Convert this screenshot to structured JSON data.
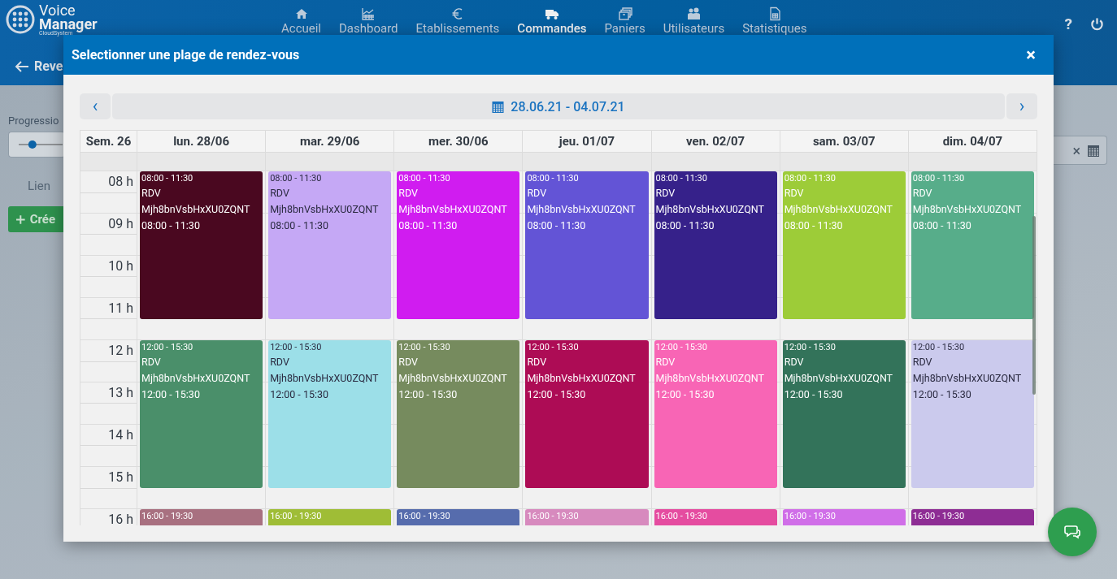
{
  "app": {
    "logo_line1": "Voice",
    "logo_line2": "Manager",
    "logo_line3": "CloudSystem"
  },
  "nav": [
    {
      "label": "Accueil",
      "selected": false
    },
    {
      "label": "Dashboard",
      "selected": false
    },
    {
      "label": "Etablissements",
      "selected": false
    },
    {
      "label": "Commandes",
      "selected": true
    },
    {
      "label": "Paniers",
      "selected": false
    },
    {
      "label": "Utilisateurs",
      "selected": false
    },
    {
      "label": "Statistiques",
      "selected": false
    }
  ],
  "help_label": "?",
  "page": {
    "back_label": "Reve",
    "progress": {
      "label": "Progressio",
      "level": 0.3
    },
    "link_label": "Lien",
    "create_button": "Crée"
  },
  "dialog": {
    "title": "Selectionner une plage de rendez-vous",
    "close": "×",
    "range": "28.06.21 - 04.07.21",
    "prev": "‹",
    "next": "›",
    "week_label": "Sem. 26",
    "hours": [
      "08 h",
      "09 h",
      "10 h",
      "11 h",
      "12 h",
      "13 h",
      "14 h",
      "15 h",
      "16 h"
    ],
    "days": [
      {
        "label": "lun. 28/06",
        "events": [
          {
            "time": "08:00 - 11:30",
            "title": "RDV",
            "ref": "Mjh8bnVsbHxXU0ZQNT",
            "time2": "08:00 - 11:30",
            "color": "#4a0820"
          },
          {
            "time": "12:00 - 15:30",
            "title": "RDV",
            "ref": "Mjh8bnVsbHxXU0ZQNT",
            "time2": "12:00 - 15:30",
            "color": "#4a8f6a"
          },
          {
            "time": "16:00 - 19:30",
            "color": "#a87080"
          }
        ]
      },
      {
        "label": "mar. 29/06",
        "events": [
          {
            "time": "08:00 - 11:30",
            "title": "RDV",
            "ref": "Mjh8bnVsbHxXU0ZQNT",
            "time2": "08:00 - 11:30",
            "color": "#c5a8f5"
          },
          {
            "time": "12:00 - 15:30",
            "title": "RDV",
            "ref": "Mjh8bnVsbHxXU0ZQNT",
            "time2": "12:00 - 15:30",
            "color": "#9cdfe8"
          },
          {
            "time": "16:00 - 19:30",
            "color": "#9fbd36"
          }
        ]
      },
      {
        "label": "mer. 30/06",
        "events": [
          {
            "time": "08:00 - 11:30",
            "title": "RDV",
            "ref": "Mjh8bnVsbHxXU0ZQNT",
            "time2": "08:00 - 11:30",
            "color": "#d01cf0"
          },
          {
            "time": "12:00 - 15:30",
            "title": "RDV",
            "ref": "Mjh8bnVsbHxXU0ZQNT",
            "time2": "12:00 - 15:30",
            "color": "#768b5e"
          },
          {
            "time": "16:00 - 19:30",
            "color": "#566cad"
          }
        ]
      },
      {
        "label": "jeu. 01/07",
        "events": [
          {
            "time": "08:00 - 11:30",
            "title": "RDV",
            "ref": "Mjh8bnVsbHxXU0ZQNT",
            "time2": "08:00 - 11:30",
            "color": "#6354d6"
          },
          {
            "time": "12:00 - 15:30",
            "title": "RDV",
            "ref": "Mjh8bnVsbHxXU0ZQNT",
            "time2": "12:00 - 15:30",
            "color": "#ad0c55"
          },
          {
            "time": "16:00 - 19:30",
            "color": "#d78abe"
          }
        ]
      },
      {
        "label": "ven. 02/07",
        "events": [
          {
            "time": "08:00 - 11:30",
            "title": "RDV",
            "ref": "Mjh8bnVsbHxXU0ZQNT",
            "time2": "08:00 - 11:30",
            "color": "#36218a"
          },
          {
            "time": "12:00 - 15:30",
            "title": "RDV",
            "ref": "Mjh8bnVsbHxXU0ZQNT",
            "time2": "12:00 - 15:30",
            "color": "#f865b5"
          },
          {
            "time": "16:00 - 19:30",
            "color": "#e54ca0"
          }
        ]
      },
      {
        "label": "sam. 03/07",
        "events": [
          {
            "time": "08:00 - 11:30",
            "title": "RDV",
            "ref": "Mjh8bnVsbHxXU0ZQNT",
            "time2": "08:00 - 11:30",
            "color": "#9dcc38"
          },
          {
            "time": "12:00 - 15:30",
            "title": "RDV",
            "ref": "Mjh8bnVsbHxXU0ZQNT",
            "time2": "12:00 - 15:30",
            "color": "#33735a"
          },
          {
            "time": "16:00 - 19:30",
            "color": "#d06ee8"
          }
        ]
      },
      {
        "label": "dim. 04/07",
        "events": [
          {
            "time": "08:00 - 11:30",
            "title": "RDV",
            "ref": "Mjh8bnVsbHxXU0ZQNT",
            "time2": "08:00 - 11:30",
            "color": "#57ad8a"
          },
          {
            "time": "12:00 - 15:30",
            "title": "RDV",
            "ref": "Mjh8bnVsbHxXU0ZQNT",
            "time2": "12:00 - 15:30",
            "color": "#cbcaed"
          },
          {
            "time": "16:00 - 19:30",
            "color": "#8e2d94"
          }
        ]
      }
    ]
  },
  "date_field": {
    "clear": "×"
  }
}
